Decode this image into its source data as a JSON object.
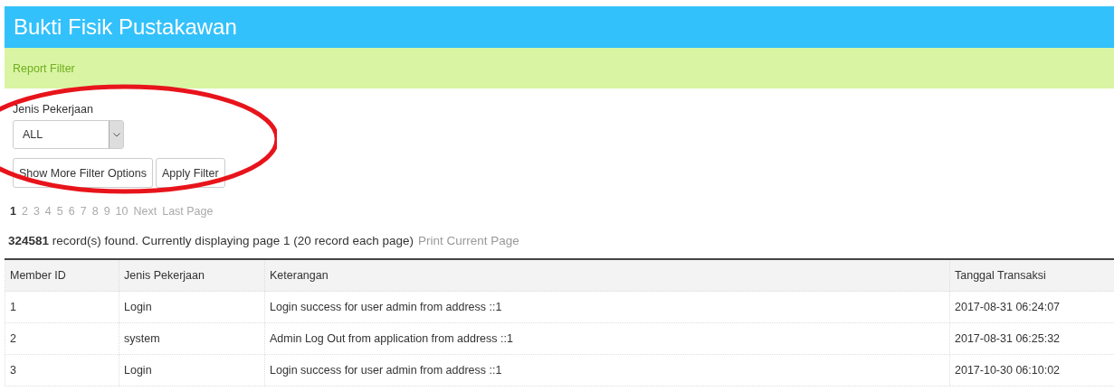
{
  "header": {
    "title": "Bukti Fisik Pustakawan"
  },
  "filter_bar": {
    "label": "Report Filter"
  },
  "filters": [
    {
      "label": "Jenis Pekerjaan",
      "value": "ALL"
    }
  ],
  "buttons": [
    "Show More Filter Options",
    "Apply Filter"
  ],
  "pagination": [
    {
      "label": "1",
      "selected": true
    },
    {
      "label": "2",
      "selected": false
    },
    {
      "label": "3",
      "selected": false
    },
    {
      "label": "4",
      "selected": false
    },
    {
      "label": "5",
      "selected": false
    },
    {
      "label": "6",
      "selected": false
    },
    {
      "label": "7",
      "selected": false
    },
    {
      "label": "8",
      "selected": false
    },
    {
      "label": "9",
      "selected": false
    },
    {
      "label": "10",
      "selected": false
    },
    {
      "label": "Next",
      "selected": false
    },
    {
      "label": "Last Page",
      "selected": false
    }
  ],
  "summary": {
    "text": "**324581** record(s) found. Currently displaying page 1 (20 record each page)",
    "link": "Print Current Page"
  },
  "table": {
    "columns": [
      "Member ID",
      "Jenis Pekerjaan",
      "Keterangan",
      "Tanggal Transaksi"
    ],
    "rows": [
      [
        "1",
        "Login",
        "Login success for user admin from address ::1",
        "2017-08-31 06:24:07"
      ],
      [
        "2",
        "system",
        "Admin Log Out from application from address ::1",
        "2017-08-31 06:25:32"
      ],
      [
        "3",
        "Login",
        "Login success for user admin from address ::1",
        "2017-10-30 06:10:02"
      ]
    ]
  },
  "annotations": [
    {
      "kind": "ellipse"
    }
  ]
}
